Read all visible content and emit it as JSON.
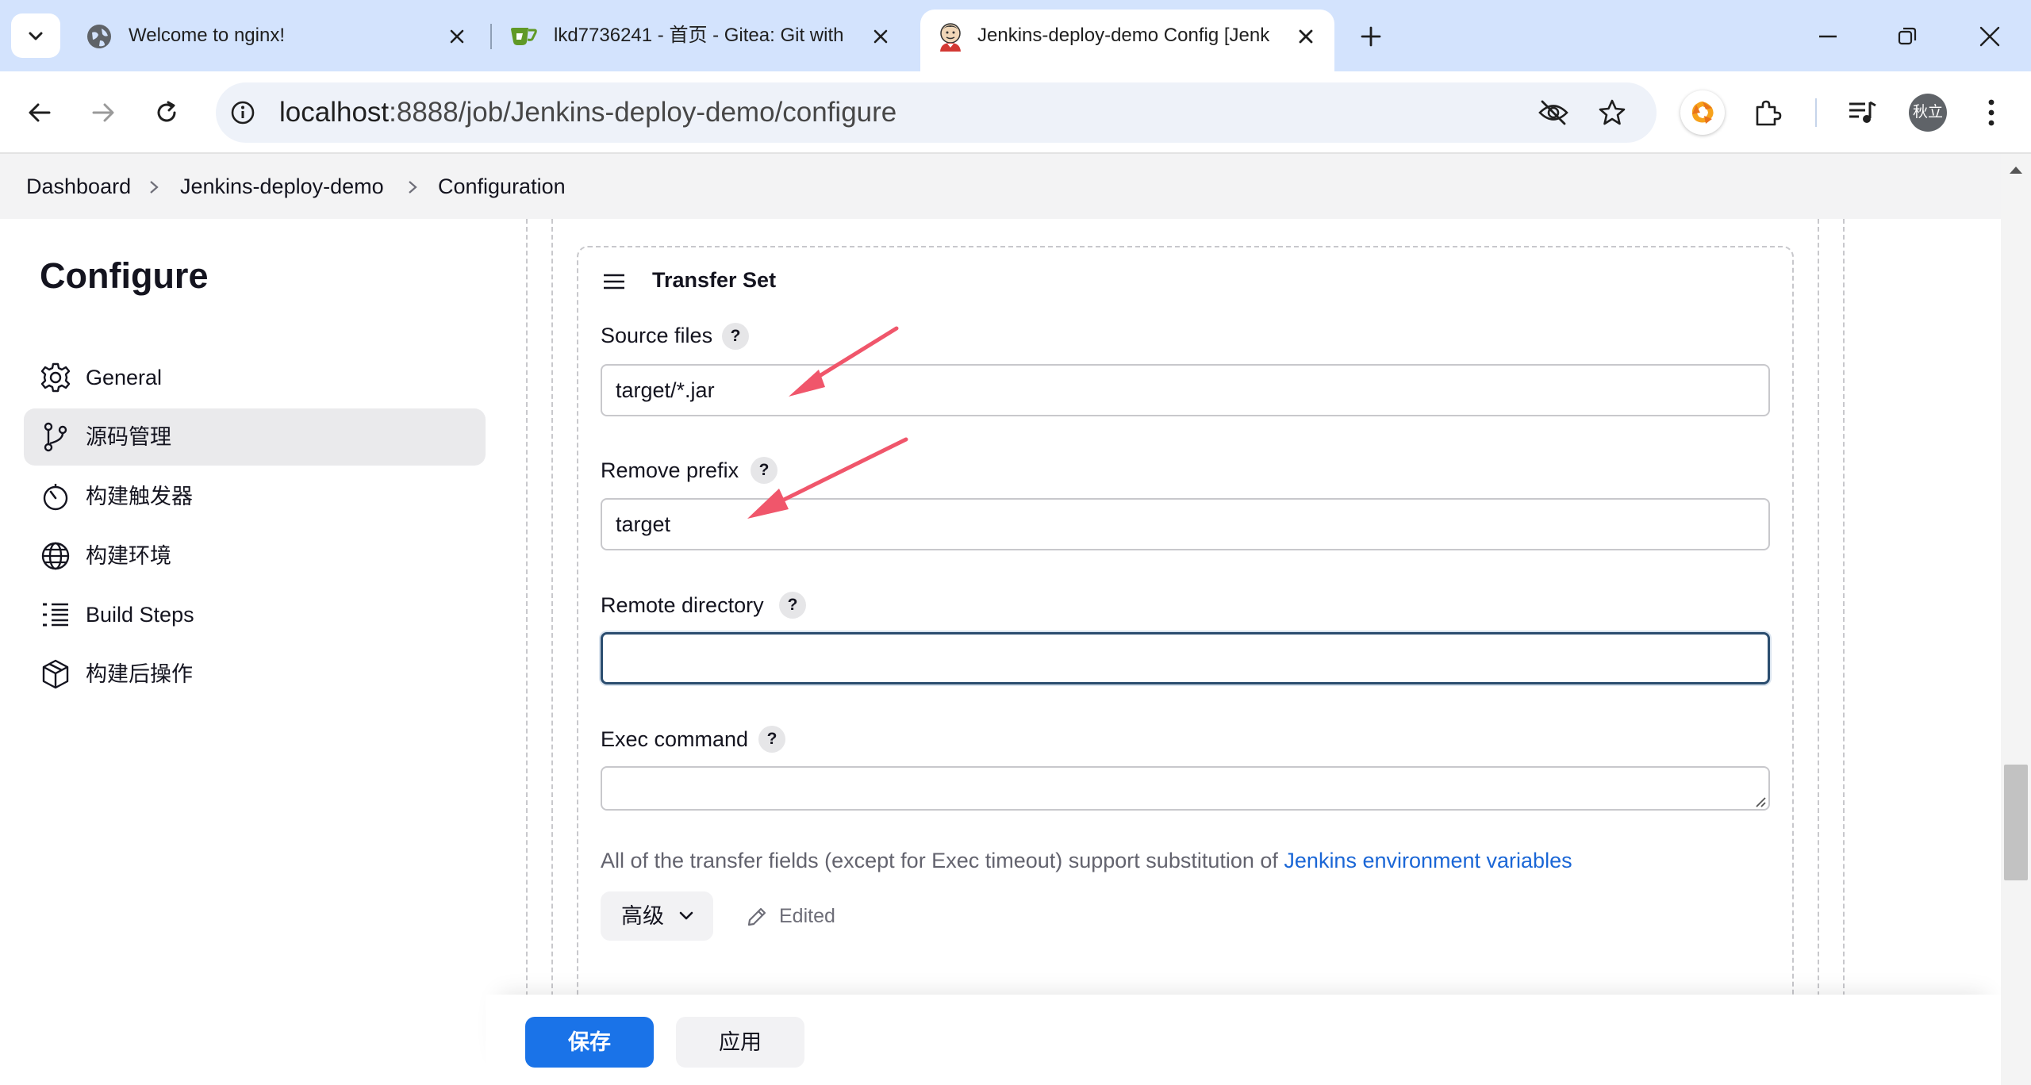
{
  "browser": {
    "tabs": [
      {
        "title": "Welcome to nginx!"
      },
      {
        "title": "lkd7736241 - 首页 - Gitea: Git with"
      },
      {
        "title": "Jenkins-deploy-demo Config [Jenk"
      }
    ],
    "url_host": "localhost",
    "url_path": ":8888/job/Jenkins-deploy-demo/configure",
    "profile_label": "秋立",
    "icons": [
      "tab-search-icon",
      "globe-icon",
      "gitea-icon",
      "jenkins-icon",
      "close-icon",
      "new-tab-icon",
      "minimize-icon",
      "restore-icon",
      "window-close-icon",
      "back-icon",
      "forward-icon",
      "reload-icon",
      "site-info-icon",
      "eye-off-icon",
      "star-icon",
      "extension-orange-icon",
      "puzzle-icon",
      "media-icon",
      "kebab-icon"
    ]
  },
  "breadcrumb": [
    "Dashboard",
    "Jenkins-deploy-demo",
    "Configuration"
  ],
  "sidebar": {
    "heading": "Configure",
    "items": [
      {
        "label": "General",
        "icon": "gear-icon"
      },
      {
        "label": "源码管理",
        "icon": "branch-icon"
      },
      {
        "label": "构建触发器",
        "icon": "timer-icon"
      },
      {
        "label": "构建环境",
        "icon": "globe-icon"
      },
      {
        "label": "Build Steps",
        "icon": "list-icon"
      },
      {
        "label": "构建后操作",
        "icon": "package-icon"
      }
    ]
  },
  "transfer_set": {
    "title": "Transfer Set",
    "fields": [
      {
        "label": "Source files",
        "value": "target/*.jar"
      },
      {
        "label": "Remove prefix",
        "value": "target"
      },
      {
        "label": "Remote directory",
        "value": ""
      },
      {
        "label": "Exec command",
        "value": ""
      }
    ],
    "help_mark": "?",
    "hint_text": "All of the transfer fields (except for Exec timeout) support substitution of ",
    "hint_link": "Jenkins environment variables",
    "advanced_label": "高级",
    "edited_label": "Edited"
  },
  "actions": {
    "save": "保存",
    "apply": "应用"
  },
  "colors": {
    "accent": "#1a73e8",
    "arrow": "#f0566b",
    "tabstrip": "#d3e3fd"
  }
}
